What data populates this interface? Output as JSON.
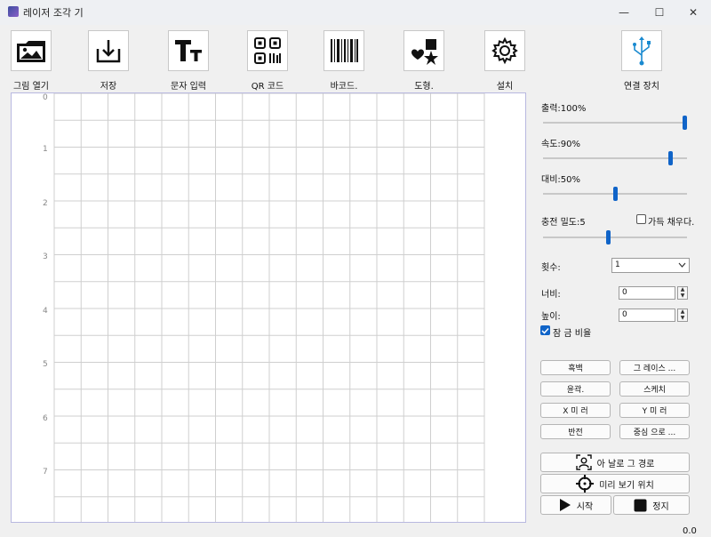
{
  "window": {
    "title": "레이저 조각 기"
  },
  "toolbar": {
    "open_image": "그림 열기",
    "save": "저장",
    "text_input": "문자 입력",
    "qr_code": "QR 코드",
    "barcode": "바코드.",
    "shape": "도형.",
    "settings": "설치",
    "connect_device": "연결 장치"
  },
  "canvas": {
    "y_labels": [
      "0",
      "1",
      "2",
      "3",
      "4",
      "5",
      "6",
      "7"
    ]
  },
  "controls": {
    "power_label": "출력:100%",
    "power_value": 100,
    "speed_label": "속도:90%",
    "speed_value": 90,
    "contrast_label": "대비:50%",
    "contrast_value": 50,
    "fill_density_label": "충전 밀도:5",
    "fill_density_value": 5,
    "fill_checkbox_label": "가득 채우다.",
    "count_label": "횟수:",
    "count_value": "1",
    "width_label": "너비:",
    "width_value": "0",
    "height_label": "높이:",
    "height_value": "0",
    "lock_ratio_label": "잠 금 비율"
  },
  "buttons": {
    "black_white": "흑백",
    "grayscale": "그 레이스 ...",
    "outline": "윤곽.",
    "sketch": "스케치",
    "x_mirror": "X 미 러",
    "y_mirror": "Y 미 러",
    "invert": "반전",
    "center": "중심 으로 ...",
    "engrave_path": "아 날로 그 경로",
    "preview_position": "미리 보기 위치",
    "start": "시작",
    "stop": "정지"
  },
  "status": {
    "value": "0.0"
  },
  "colors": {
    "accent": "#1064c8"
  }
}
